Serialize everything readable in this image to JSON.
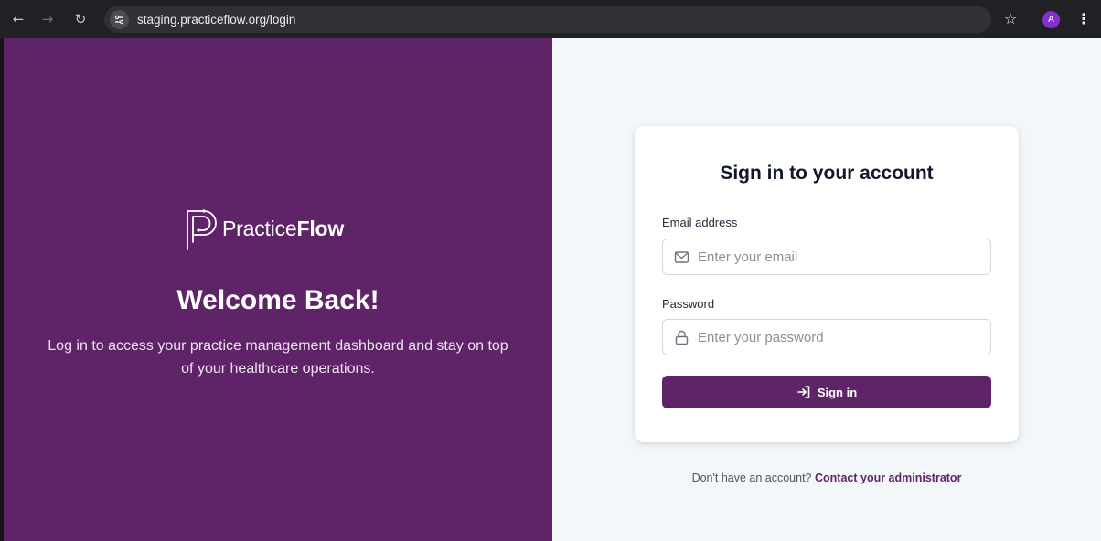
{
  "browser": {
    "url": "staging.practiceflow.org/login",
    "profile_initial": "A",
    "icons": [
      "back-arrow-icon",
      "forward-arrow-icon",
      "reload-icon",
      "site-info-icon",
      "bookmark-star-icon",
      "kebab-menu-icon"
    ]
  },
  "brand": {
    "name_light": "Practice",
    "name_bold": "Flow",
    "logo_icon": "practiceflow-logo-icon"
  },
  "hero": {
    "title": "Welcome Back!",
    "subtitle": "Log in to access your practice management dashboard and stay on top of your healthcare operations."
  },
  "login_form": {
    "title": "Sign in to your account",
    "email": {
      "label": "Email address",
      "placeholder": "Enter your email",
      "value": "",
      "icon": "mail-icon"
    },
    "password": {
      "label": "Password",
      "placeholder": "Enter your password",
      "value": "",
      "icon": "lock-icon"
    },
    "submit": {
      "label": "Sign in",
      "icon": "sign-in-icon"
    }
  },
  "footer": {
    "prompt": "Don't have an account?",
    "link_label": "Contact your administrator"
  },
  "colors": {
    "brand_purple": "#5f2468",
    "right_background": "#f3f7f9",
    "browser_chrome": "#202124",
    "avatar": "#8430ce"
  }
}
